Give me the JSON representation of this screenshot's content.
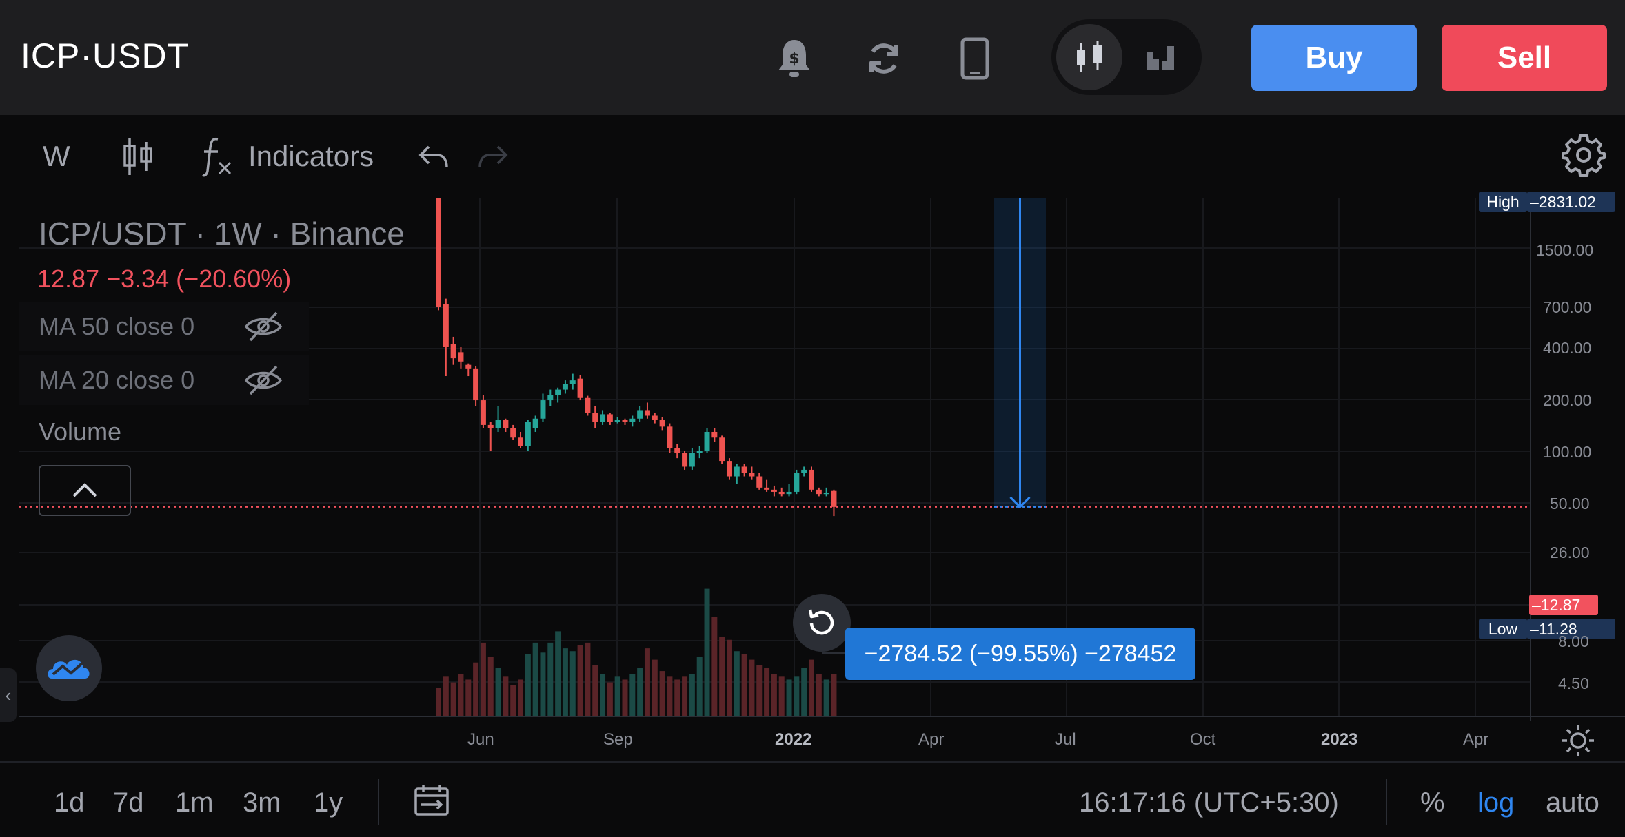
{
  "header": {
    "pair_title": "ICP·USDT",
    "icons": [
      "price-alert-icon",
      "refresh-icon",
      "mobile-device-icon",
      "candles-icon",
      "depth-chart-icon"
    ],
    "buy_label": "Buy",
    "sell_label": "Sell",
    "buy_color": "#4a8ef0",
    "sell_color": "#f04a5a"
  },
  "toolbar": {
    "interval": "W",
    "indicators_label": "Indicators",
    "icons": [
      "candle-type-icon",
      "function-icon",
      "undo-icon",
      "redo-icon",
      "gear-icon"
    ]
  },
  "legend": {
    "title": "ICP/USDT · 1W · Binance",
    "price_change": "12.87  −3.34 (−20.60%)",
    "ma50": "MA 50 close 0",
    "ma20": "MA 20 close 0",
    "volume": "Volume"
  },
  "measure": {
    "tooltip": "−2784.52 (−99.55%) −278452"
  },
  "price_axis": {
    "high_label": "High",
    "high_value": "2831.02",
    "low_label": "Low",
    "low_value": "11.28",
    "last_price": "12.87",
    "ticks": [
      "1500.00",
      "700.00",
      "400.00",
      "200.00",
      "100.00",
      "50.00",
      "26.00",
      "8.00",
      "4.50"
    ]
  },
  "time_axis": {
    "labels": [
      "Jun",
      "Sep",
      "2022",
      "Apr",
      "Jul",
      "Oct",
      "2023",
      "Apr"
    ],
    "bold": [
      false,
      false,
      true,
      false,
      false,
      false,
      true,
      false
    ]
  },
  "bottom": {
    "ranges": [
      "1d",
      "7d",
      "1m",
      "3m",
      "1y"
    ],
    "time": "16:17:16 (UTC+5:30)",
    "percent": "%",
    "log": "log",
    "auto": "auto"
  },
  "colors": {
    "up": "#26a69a",
    "down": "#ef5350",
    "accent": "#2077d6",
    "background": "#0a0a0b"
  },
  "chart_data": {
    "type": "candlestick",
    "interval": "1W",
    "exchange": "Binance",
    "symbol": "ICP/USDT",
    "y_scale": "log",
    "ylim": [
      4.0,
      2831.02
    ],
    "grid": true,
    "candles": [
      {
        "o": 2831.02,
        "h": 2831.02,
        "l": 220.0,
        "c": 230.0
      },
      {
        "o": 240.0,
        "h": 260.0,
        "l": 85.0,
        "c": 130.0
      },
      {
        "o": 135.0,
        "h": 150.0,
        "l": 100.0,
        "c": 110.0
      },
      {
        "o": 120.0,
        "h": 130.0,
        "l": 95.0,
        "c": 105.0
      },
      {
        "o": 100.0,
        "h": 102.0,
        "l": 85.0,
        "c": 95.0
      },
      {
        "o": 95.0,
        "h": 98.0,
        "l": 55.0,
        "c": 60.0
      },
      {
        "o": 60.0,
        "h": 65.0,
        "l": 40.0,
        "c": 42.0
      },
      {
        "o": 42.0,
        "h": 44.0,
        "l": 29.0,
        "c": 40.0
      },
      {
        "o": 40.0,
        "h": 55.0,
        "l": 38.0,
        "c": 45.0
      },
      {
        "o": 45.0,
        "h": 46.0,
        "l": 38.0,
        "c": 40.0
      },
      {
        "o": 40.0,
        "h": 42.0,
        "l": 34.0,
        "c": 35.0
      },
      {
        "o": 35.0,
        "h": 38.0,
        "l": 30.0,
        "c": 31.0
      },
      {
        "o": 31.0,
        "h": 45.0,
        "l": 29.0,
        "c": 44.0
      },
      {
        "o": 40.0,
        "h": 48.0,
        "l": 38.0,
        "c": 46.0
      },
      {
        "o": 46.0,
        "h": 66.0,
        "l": 44.0,
        "c": 60.0
      },
      {
        "o": 60.0,
        "h": 70.0,
        "l": 55.0,
        "c": 65.0
      },
      {
        "o": 65.0,
        "h": 72.0,
        "l": 58.0,
        "c": 70.0
      },
      {
        "o": 70.0,
        "h": 80.0,
        "l": 66.0,
        "c": 76.0
      },
      {
        "o": 76.0,
        "h": 88.0,
        "l": 70.0,
        "c": 80.0
      },
      {
        "o": 82.0,
        "h": 86.0,
        "l": 60.0,
        "c": 62.0
      },
      {
        "o": 62.0,
        "h": 64.0,
        "l": 48.0,
        "c": 50.0
      },
      {
        "o": 50.0,
        "h": 55.0,
        "l": 40.0,
        "c": 44.0
      },
      {
        "o": 44.0,
        "h": 52.0,
        "l": 42.0,
        "c": 49.0
      },
      {
        "o": 49.0,
        "h": 50.0,
        "l": 42.0,
        "c": 44.0
      },
      {
        "o": 44.0,
        "h": 47.0,
        "l": 43.0,
        "c": 45.0
      },
      {
        "o": 45.0,
        "h": 46.0,
        "l": 42.0,
        "c": 44.0
      },
      {
        "o": 44.0,
        "h": 48.0,
        "l": 41.0,
        "c": 46.0
      },
      {
        "o": 46.0,
        "h": 55.0,
        "l": 44.0,
        "c": 52.0
      },
      {
        "o": 52.0,
        "h": 58.0,
        "l": 46.0,
        "c": 48.0
      },
      {
        "o": 48.0,
        "h": 50.0,
        "l": 43.0,
        "c": 45.0
      },
      {
        "o": 45.0,
        "h": 47.0,
        "l": 39.0,
        "c": 41.0
      },
      {
        "o": 41.0,
        "h": 43.0,
        "l": 28.0,
        "c": 30.0
      },
      {
        "o": 30.0,
        "h": 32.0,
        "l": 26.0,
        "c": 28.0
      },
      {
        "o": 28.0,
        "h": 29.0,
        "l": 22.0,
        "c": 23.0
      },
      {
        "o": 23.0,
        "h": 30.0,
        "l": 22.0,
        "c": 28.0
      },
      {
        "o": 28.0,
        "h": 31.0,
        "l": 26.0,
        "c": 29.0
      },
      {
        "o": 29.0,
        "h": 40.0,
        "l": 28.0,
        "c": 38.0
      },
      {
        "o": 38.0,
        "h": 40.0,
        "l": 33.0,
        "c": 35.0
      },
      {
        "o": 35.0,
        "h": 36.0,
        "l": 24.0,
        "c": 25.0
      },
      {
        "o": 25.0,
        "h": 26.0,
        "l": 19.0,
        "c": 20.0
      },
      {
        "o": 20.0,
        "h": 24.0,
        "l": 18.0,
        "c": 23.0
      },
      {
        "o": 23.0,
        "h": 24.0,
        "l": 20.0,
        "c": 21.0
      },
      {
        "o": 21.0,
        "h": 23.0,
        "l": 19.0,
        "c": 20.0
      },
      {
        "o": 20.0,
        "h": 21.0,
        "l": 16.5,
        "c": 17.0
      },
      {
        "o": 17.0,
        "h": 19.0,
        "l": 16.0,
        "c": 16.5
      },
      {
        "o": 16.5,
        "h": 17.5,
        "l": 15.0,
        "c": 16.0
      },
      {
        "o": 16.0,
        "h": 17.0,
        "l": 15.0,
        "c": 15.5
      },
      {
        "o": 15.5,
        "h": 18.0,
        "l": 15.0,
        "c": 16.0
      },
      {
        "o": 16.0,
        "h": 22.0,
        "l": 15.5,
        "c": 21.0
      },
      {
        "o": 21.0,
        "h": 23.0,
        "l": 20.0,
        "c": 22.0
      },
      {
        "o": 22.0,
        "h": 23.0,
        "l": 16.0,
        "c": 16.5
      },
      {
        "o": 16.5,
        "h": 17.0,
        "l": 15.0,
        "c": 15.5
      },
      {
        "o": 15.5,
        "h": 17.0,
        "l": 15.0,
        "c": 15.8
      },
      {
        "o": 16.2,
        "h": 16.5,
        "l": 11.28,
        "c": 12.87
      }
    ],
    "volume": [
      20,
      28,
      24,
      30,
      26,
      38,
      52,
      42,
      34,
      28,
      22,
      26,
      44,
      52,
      45,
      52,
      60,
      48,
      46,
      50,
      52,
      36,
      30,
      24,
      28,
      26,
      30,
      34,
      48,
      40,
      32,
      28,
      26,
      28,
      30,
      42,
      90,
      70,
      56,
      54,
      46,
      44,
      40,
      36,
      34,
      30,
      28,
      26,
      28,
      34,
      40,
      30,
      26,
      30
    ],
    "last_price": 12.87,
    "high": 2831.02,
    "low": 11.28,
    "measurement": {
      "change": -2784.52,
      "change_percent": -99.55,
      "ticks": -278452
    }
  }
}
